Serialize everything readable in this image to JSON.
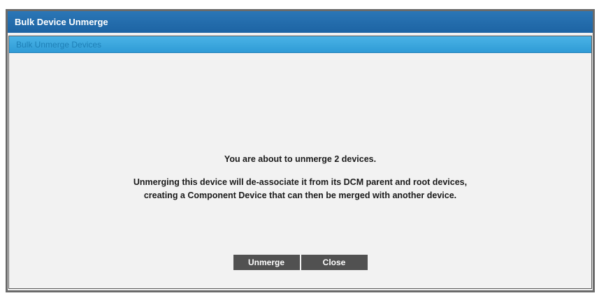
{
  "window": {
    "title": "Bulk Device Unmerge"
  },
  "panel": {
    "header": "Bulk Unmerge Devices"
  },
  "message": {
    "main": "You are about to unmerge 2 devices.",
    "detail_line1": "Unmerging this device will de-associate it from its DCM parent and root devices,",
    "detail_line2": "creating a Component Device that can then be merged with another device."
  },
  "buttons": {
    "unmerge": "Unmerge",
    "close": "Close"
  },
  "colors": {
    "title_bar": "#1d64a3",
    "panel_header": "#2f9bd6",
    "button": "#515151",
    "background": "#f2f2f2"
  }
}
